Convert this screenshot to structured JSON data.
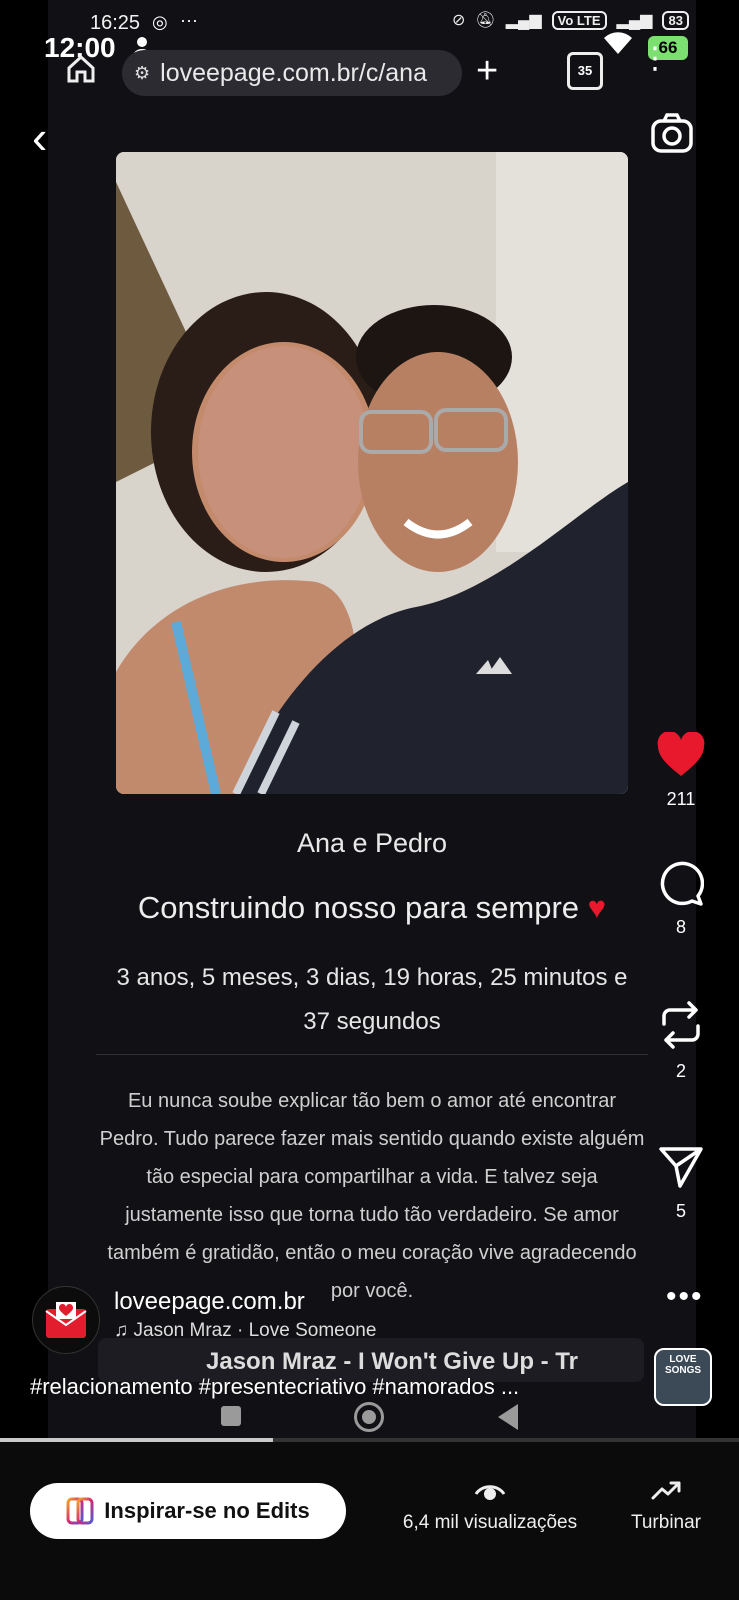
{
  "status_bar": {
    "time": "12:00",
    "battery": "66"
  },
  "inner_status_bar": {
    "time": "16:25",
    "battery": "83",
    "volte": "Vo LTE"
  },
  "browser": {
    "url": "loveepage.com.br/c/ana",
    "tabs_count": "35"
  },
  "page": {
    "names": "Ana e Pedro",
    "title": "Construindo nosso para sempre",
    "counter": "3 anos, 5 meses, 3 dias, 19 horas, 25 minutos e 37 segundos",
    "message": "Eu nunca soube explicar tão bem o amor até encontrar Pedro. Tudo parece fazer mais sentido quando existe alguém tão especial para compartilhar a vida. E talvez seja justamente isso que torna tudo tão verdadeiro. Se amor também é gratidão, então o meu coração vive agradecendo por você.",
    "music_player_text": "Jason Mraz - I Won't Give Up - Tr"
  },
  "actions": {
    "likes": "211",
    "comments": "8",
    "reposts": "2",
    "shares": "5"
  },
  "creator": {
    "username": "loveepage.com.br",
    "audio": "Jason Mraz · Love Someone",
    "hashtags": "#relacionamento #presentecriativo #namorados ...",
    "album_thumb_text": "LOVE SONGS"
  },
  "video": {
    "progress": 0.37
  },
  "bottom_bar": {
    "edits_label": "Inspirar-se no Edits",
    "views_label": "6,4 mil visualizações",
    "boost_label": "Turbinar"
  },
  "colors": {
    "like_red": "#e8192c",
    "battery_green": "#7be06f",
    "edits_gradient": [
      "#f5a623",
      "#d62976",
      "#4f5bd5"
    ]
  }
}
